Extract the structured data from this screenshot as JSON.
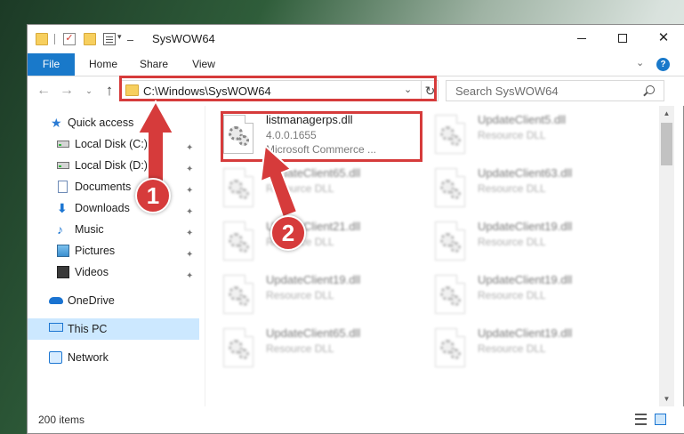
{
  "window": {
    "title": "SysWOW64",
    "minimize": "—",
    "maximize": "☐",
    "close": "✕"
  },
  "ribbon": {
    "tabs": [
      "File",
      "Home",
      "Share",
      "View"
    ],
    "collapse_chevron": "⌄",
    "help": "?"
  },
  "nav": {
    "back": "←",
    "forward": "→",
    "recent": "⌄",
    "up": "↑",
    "address": "C:\\Windows\\SysWOW64",
    "address_dropdown": "⌄",
    "refresh": "↻",
    "search_placeholder": "Search SysWOW64"
  },
  "sidebar": {
    "items": [
      {
        "label": "Quick access",
        "icon": "star-icon"
      },
      {
        "label": "Local Disk (C:)",
        "icon": "disk-icon",
        "pinned": true
      },
      {
        "label": "Local Disk (D:)",
        "icon": "disk-icon",
        "pinned": true
      },
      {
        "label": "Documents",
        "icon": "documents-icon",
        "pinned": true
      },
      {
        "label": "Downloads",
        "icon": "downloads-icon",
        "pinned": true
      },
      {
        "label": "Music",
        "icon": "music-icon",
        "pinned": true
      },
      {
        "label": "Pictures",
        "icon": "pictures-icon",
        "pinned": true
      },
      {
        "label": "Videos",
        "icon": "videos-icon",
        "pinned": true
      },
      {
        "label": "OneDrive",
        "icon": "onedrive-icon"
      },
      {
        "label": "This PC",
        "icon": "pc-icon",
        "selected": true
      },
      {
        "label": "Network",
        "icon": "network-icon"
      }
    ],
    "pin_glyph": "📌"
  },
  "files": [
    {
      "name": "listmanagerps.dll",
      "line2": "4.0.0.1655",
      "line3": "Microsoft Commerce ...",
      "highlighted": true
    },
    {
      "name": "UpdateClient5.dll",
      "line2": "Resource DLL",
      "blurred": true
    },
    {
      "name": "UpdateClient65.dll",
      "line2": "Resource DLL",
      "blurred": true
    },
    {
      "name": "UpdateClient63.dll",
      "line2": "Resource DLL",
      "blurred": true
    },
    {
      "name": "UpdateClient21.dll",
      "line2": "Resource DLL",
      "blurred": true
    },
    {
      "name": "UpdateClient19.dll",
      "line2": "Resource DLL",
      "blurred": true
    },
    {
      "name": "UpdateClient19.dll",
      "line2": "Resource DLL",
      "blurred": true
    },
    {
      "name": "UpdateClient19.dll",
      "line2": "Resource DLL",
      "blurred": true
    },
    {
      "name": "UpdateClient65.dll",
      "line2": "Resource DLL",
      "blurred": true
    },
    {
      "name": "UpdateClient19.dll",
      "line2": "Resource DLL",
      "blurred": true
    }
  ],
  "status": {
    "item_count": "200 items"
  },
  "annotations": {
    "callout1": "1",
    "callout2": "2",
    "accent_color": "#d63b3b"
  }
}
